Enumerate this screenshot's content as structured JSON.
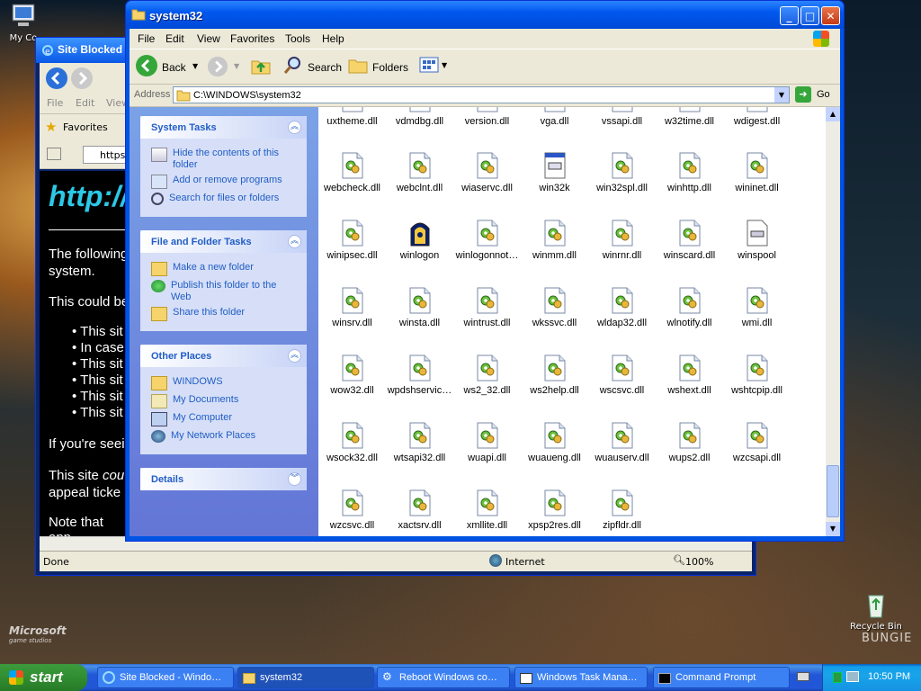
{
  "desktop": {
    "icons": [
      {
        "label": "My Co"
      },
      {
        "label": "Recycle Bin"
      }
    ],
    "brand_left": "Microsoft",
    "brand_left_sub": "game studios",
    "brand_right": "BUNGIE"
  },
  "ie_window": {
    "title": "Site Blocked",
    "menu": [
      "File",
      "Edit",
      "View"
    ],
    "favorites_label": "Favorites",
    "address_text": "https:",
    "page": {
      "heading": "http://",
      "para1a": "The following",
      "para1b": "system.",
      "para2": "This could be",
      "bullets": [
        "This sit",
        "In case",
        "This sit",
        "This sit",
        "This sit",
        "This sit"
      ],
      "para3": "If you're seei",
      "para4a_plain": "This site ",
      "para4a_italic": "cou",
      "para4b": "appeal ticke",
      "para5": "Note that app"
    },
    "status": {
      "left": "Done",
      "zone": "Internet",
      "zoom": "100%"
    }
  },
  "explorer": {
    "title": "system32",
    "menu": [
      "File",
      "Edit",
      "View",
      "Favorites",
      "Tools",
      "Help"
    ],
    "toolbar": {
      "back": "Back",
      "search": "Search",
      "folders": "Folders"
    },
    "address_label": "Address",
    "address_value": "C:\\WINDOWS\\system32",
    "go_label": "Go",
    "panels": {
      "system_tasks": {
        "title": "System Tasks",
        "items": [
          "Hide the contents of this folder",
          "Add or remove programs",
          "Search for files or folders"
        ]
      },
      "file_folder_tasks": {
        "title": "File and Folder Tasks",
        "items": [
          "Make a new folder",
          "Publish this folder to the Web",
          "Share this folder"
        ]
      },
      "other_places": {
        "title": "Other Places",
        "items": [
          "WINDOWS",
          "My Documents",
          "My Computer",
          "My Network Places"
        ]
      },
      "details": {
        "title": "Details"
      }
    },
    "top_row": [
      "uxtheme.dll",
      "vdmdbg.dll",
      "version.dll",
      "vga.dll",
      "vssapi.dll",
      "w32time.dll",
      "wdigest.dll"
    ],
    "rows": [
      [
        {
          "n": "webcheck.dll",
          "t": "dll"
        },
        {
          "n": "webclnt.dll",
          "t": "dll"
        },
        {
          "n": "wiaservc.dll",
          "t": "dll"
        },
        {
          "n": "win32k",
          "t": "sys"
        },
        {
          "n": "win32spl.dll",
          "t": "dll"
        },
        {
          "n": "winhttp.dll",
          "t": "dll"
        },
        {
          "n": "wininet.dll",
          "t": "dll"
        }
      ],
      [
        {
          "n": "winipsec.dll",
          "t": "dll"
        },
        {
          "n": "winlogon",
          "t": "exe"
        },
        {
          "n": "winlogonnot…",
          "t": "dll"
        },
        {
          "n": "winmm.dll",
          "t": "dll"
        },
        {
          "n": "winrnr.dll",
          "t": "dll"
        },
        {
          "n": "winscard.dll",
          "t": "dll"
        },
        {
          "n": "winspool",
          "t": "doc"
        }
      ],
      [
        {
          "n": "winsrv.dll",
          "t": "dll"
        },
        {
          "n": "winsta.dll",
          "t": "dll"
        },
        {
          "n": "wintrust.dll",
          "t": "dll"
        },
        {
          "n": "wkssvc.dll",
          "t": "dll"
        },
        {
          "n": "wldap32.dll",
          "t": "dll"
        },
        {
          "n": "wlnotify.dll",
          "t": "dll"
        },
        {
          "n": "wmi.dll",
          "t": "dll"
        }
      ],
      [
        {
          "n": "wow32.dll",
          "t": "dll"
        },
        {
          "n": "wpdshservic…",
          "t": "dll"
        },
        {
          "n": "ws2_32.dll",
          "t": "dll"
        },
        {
          "n": "ws2help.dll",
          "t": "dll"
        },
        {
          "n": "wscsvc.dll",
          "t": "dll"
        },
        {
          "n": "wshext.dll",
          "t": "dll"
        },
        {
          "n": "wshtcpip.dll",
          "t": "dll"
        }
      ],
      [
        {
          "n": "wsock32.dll",
          "t": "dll"
        },
        {
          "n": "wtsapi32.dll",
          "t": "dll"
        },
        {
          "n": "wuapi.dll",
          "t": "dll"
        },
        {
          "n": "wuaueng.dll",
          "t": "dll"
        },
        {
          "n": "wuauserv.dll",
          "t": "dll"
        },
        {
          "n": "wups2.dll",
          "t": "dll"
        },
        {
          "n": "wzcsapi.dll",
          "t": "dll"
        }
      ],
      [
        {
          "n": "wzcsvc.dll",
          "t": "dll"
        },
        {
          "n": "xactsrv.dll",
          "t": "dll"
        },
        {
          "n": "xmllite.dll",
          "t": "dll"
        },
        {
          "n": "xpsp2res.dll",
          "t": "dll"
        },
        {
          "n": "zipfldr.dll",
          "t": "dll"
        }
      ]
    ]
  },
  "taskbar": {
    "start_label": "start",
    "buttons": [
      "Site Blocked - Windo…",
      "system32",
      "Reboot Windows co…",
      "Windows Task Mana…",
      "Command Prompt"
    ],
    "clock": "10:50 PM"
  },
  "colors": {
    "xp_blue": "#0054e3",
    "link_blue": "#215dc6",
    "start_green": "#2f8a2f"
  }
}
